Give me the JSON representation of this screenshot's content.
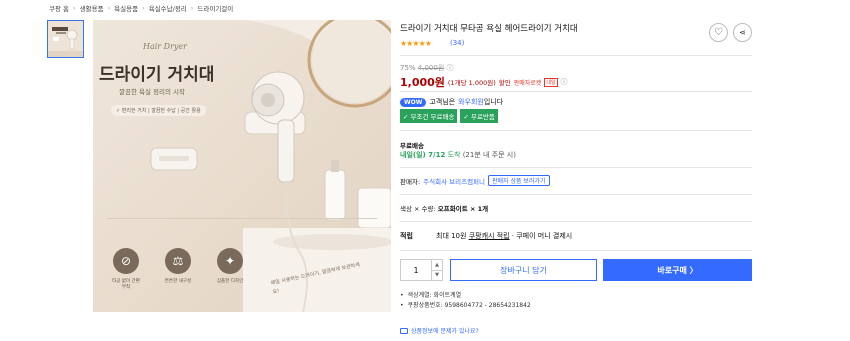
{
  "breadcrumb": [
    "쿠팡 홈",
    "생활용품",
    "욕실용품",
    "욕실수납/정리",
    "드라이기걸이"
  ],
  "product": {
    "title": "드라이기 거치대 무타공 욕실 헤어드라이기 거치대",
    "rating_stars": "★★★★★",
    "review_count": "(34)",
    "discount_rate": "75%",
    "original_price": "4,000원",
    "info_mark": "ⓘ",
    "price": "1,000원",
    "unit_price": "(1개당 1,000원)",
    "sale_label": "할인",
    "seller_tag": "판매자로켓",
    "seller_tag_small": "내일",
    "wow_badge": "WOW",
    "wow_text": "고객님은",
    "wow_link": "와우회원",
    "wow_suffix": "입니다",
    "ship_badges": [
      "✓ 무조건 무료배송",
      "✓ 무료반품"
    ],
    "delivery_label": "무료배송",
    "delivery_date": "내일(일) 7/12",
    "delivery_arrive": "도착",
    "delivery_cutoff": "(21분 내 주문 시)",
    "seller_label": "판매자:",
    "seller_name": "주식회사 브리즈컴퍼니",
    "seller_more": "판매자 상품 보러가기",
    "option_label": "색상 × 수량:",
    "option_value": "오프화이트 × 1개",
    "reward_label": "적립",
    "reward_text": "최대 10원",
    "reward_link": "쿠팡캐시 적립",
    "reward_suffix": "· 쿠페이 머니 결제시",
    "quantity": "1",
    "cart_label": "장바구니 담기",
    "buy_label": "바로구매 〉",
    "info_lines": [
      "색상계열: 화이트계열",
      "쿠팡상품번호: 9598604772 - 28654231842"
    ],
    "problem_link": "상품정보에 문제가 있나요?"
  },
  "hero": {
    "script_text": "Hair Dryer",
    "headline": "드라이기 거치대",
    "subline": "깔끔한 욕실 정리의 시작",
    "chips": "✓ 편리한 거치 | 깔끔한 수납 | 공간 활용",
    "features": [
      "타공 없이 간편 부착",
      "튼튼한 내구성",
      "심플한 디자인"
    ],
    "handwriting": "매일 사용하는 드라이기, 깔끔하게 보관하세요!"
  }
}
